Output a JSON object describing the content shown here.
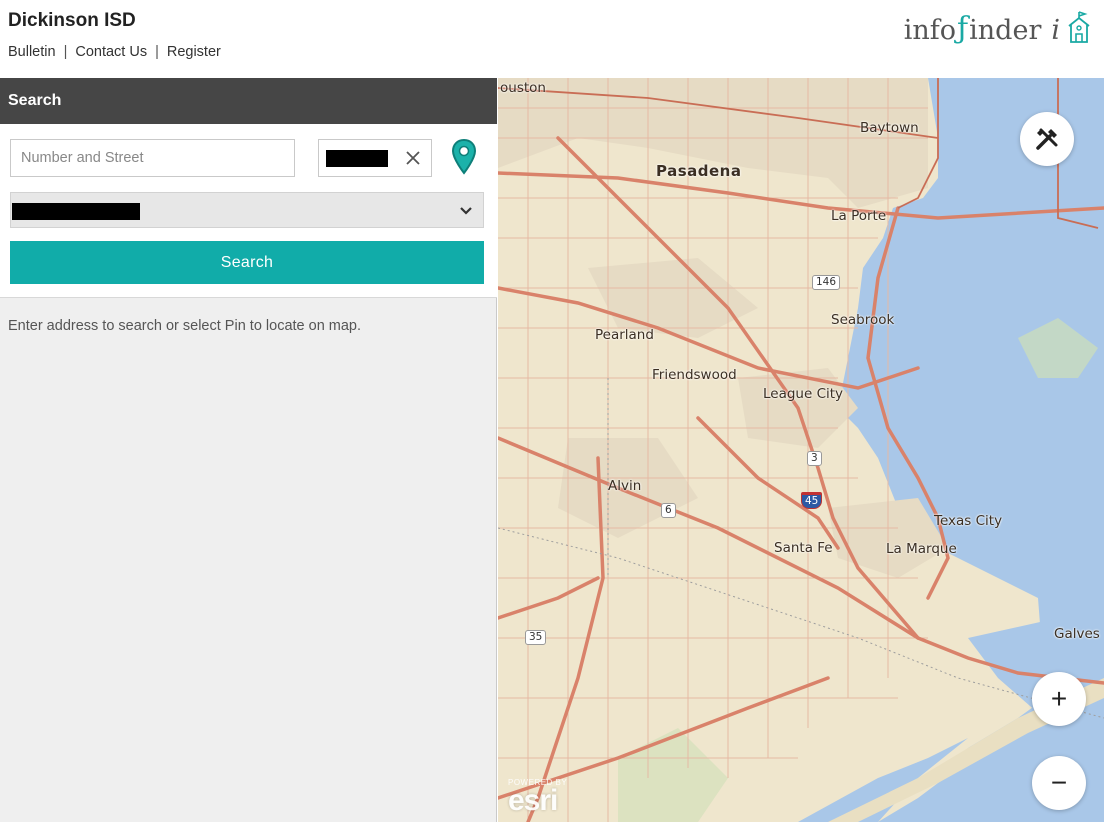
{
  "header": {
    "title": "Dickinson ISD",
    "nav": [
      "Bulletin",
      "Contact Us",
      "Register"
    ],
    "logo": {
      "text_a": "info",
      "text_b": "inder",
      "text_c": "i"
    }
  },
  "panel": {
    "heading": "Search",
    "street_placeholder": "Number and Street",
    "search_button": "Search",
    "hint": "Enter address to search or select Pin to locate on map."
  },
  "map": {
    "labels": {
      "houston": "ouston",
      "baytown": "Baytown",
      "pasadena": "Pasadena",
      "laporte": "La Porte",
      "seabrook": "Seabrook",
      "pearland": "Pearland",
      "friendswood": "Friendswood",
      "leaguecity": "League City",
      "alvin": "Alvin",
      "texascity": "Texas City",
      "santafe": "Santa Fe",
      "lamarque": "La Marque",
      "galves": "Galves"
    },
    "shields": {
      "r146": "146",
      "r3": "3",
      "r45": "45",
      "r6": "6",
      "r35": "35"
    },
    "attribution": {
      "powered": "POWERED BY",
      "brand": "esri"
    },
    "zoom_in": "+",
    "zoom_out": "−"
  },
  "colors": {
    "accent": "#11aca9",
    "header_bar": "#464646",
    "water": "#a9c7e8",
    "land": "#efe6cd",
    "road": "#d9826a"
  }
}
